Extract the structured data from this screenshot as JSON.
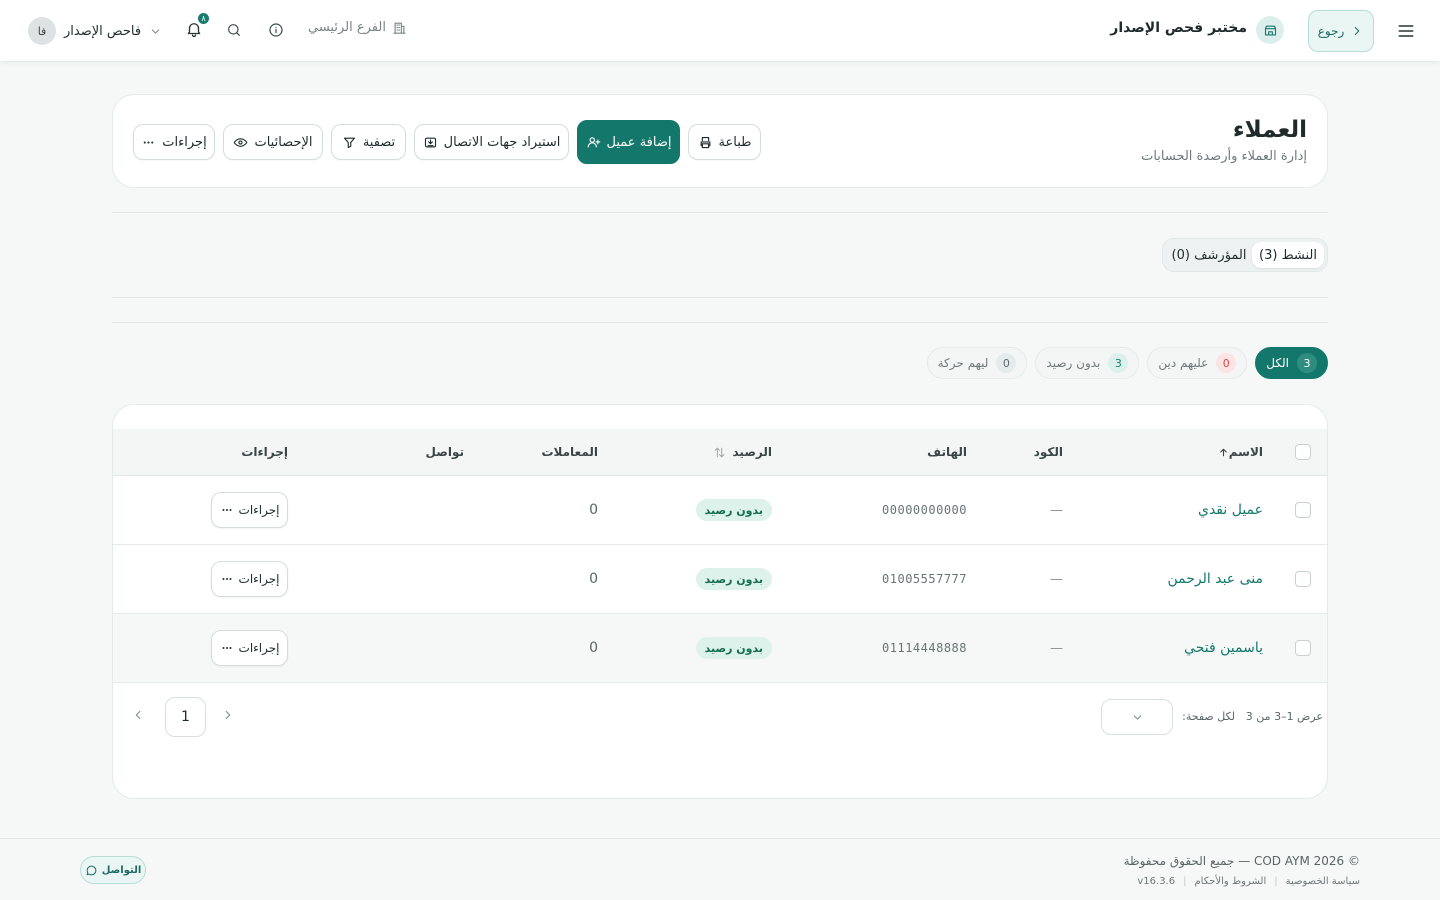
{
  "topbar": {
    "back_label": "رجوع",
    "app_title": "مختبر فحص الإصدار",
    "branch_label": "الفرع الرئيسي",
    "notification_count": "٨",
    "user_name": "فاحص الإصدار",
    "user_initials": "فا"
  },
  "header": {
    "title": "العملاء",
    "subtitle": "إدارة العملاء وأرصدة الحسابات",
    "buttons": {
      "print": "طباعة",
      "add_customer": "إضافة عميل",
      "import_contacts": "استيراد جهات الاتصال",
      "filter": "تصفية",
      "stats": "الإحصائيات",
      "actions": "إجراءات"
    }
  },
  "status_tabs": [
    {
      "label": "النشط (3)",
      "active": true
    },
    {
      "label": "المؤرشف (0)",
      "active": false
    }
  ],
  "filter_pills": [
    {
      "label": "الكل",
      "count": "3"
    },
    {
      "label": "عليهم دين",
      "count": "0"
    },
    {
      "label": "بدون رصيد",
      "count": "3"
    },
    {
      "label": "ليهم حركة",
      "count": "0"
    }
  ],
  "table": {
    "headers": {
      "name": "الاسم",
      "code": "الكود",
      "phone": "الهاتف",
      "balance": "الرصيد",
      "transactions": "المعاملات",
      "contact": "تواصل",
      "actions": "إجراءات"
    },
    "rows": [
      {
        "name": "عميل نقدي",
        "code": "—",
        "phone": "00000000000",
        "balance": "بدون رصيد",
        "transactions": "0",
        "actions": "إجراءات"
      },
      {
        "name": "منى عبد الرحمن",
        "code": "—",
        "phone": "01005557777",
        "balance": "بدون رصيد",
        "transactions": "0",
        "actions": "إجراءات"
      },
      {
        "name": "ياسمين فتحي",
        "code": "—",
        "phone": "01114448888",
        "balance": "بدون رصيد",
        "transactions": "0",
        "actions": "إجراءات"
      }
    ]
  },
  "pagination": {
    "info": "عرض 1–3 من 3",
    "per_page_label": "لكل صفحة:",
    "current_page": "1"
  },
  "footer": {
    "copyright": "© 2026 COD AYM — جميع الحقوق محفوظة",
    "privacy": "سياسة الخصوصية",
    "terms": "الشروط والأحكام",
    "version": "v16.3.6",
    "contact_label": "التواصل"
  },
  "colors": {
    "accent": "#13786b",
    "badge_bg": "#ddf2ea",
    "debt_count": "#d04b4b"
  }
}
